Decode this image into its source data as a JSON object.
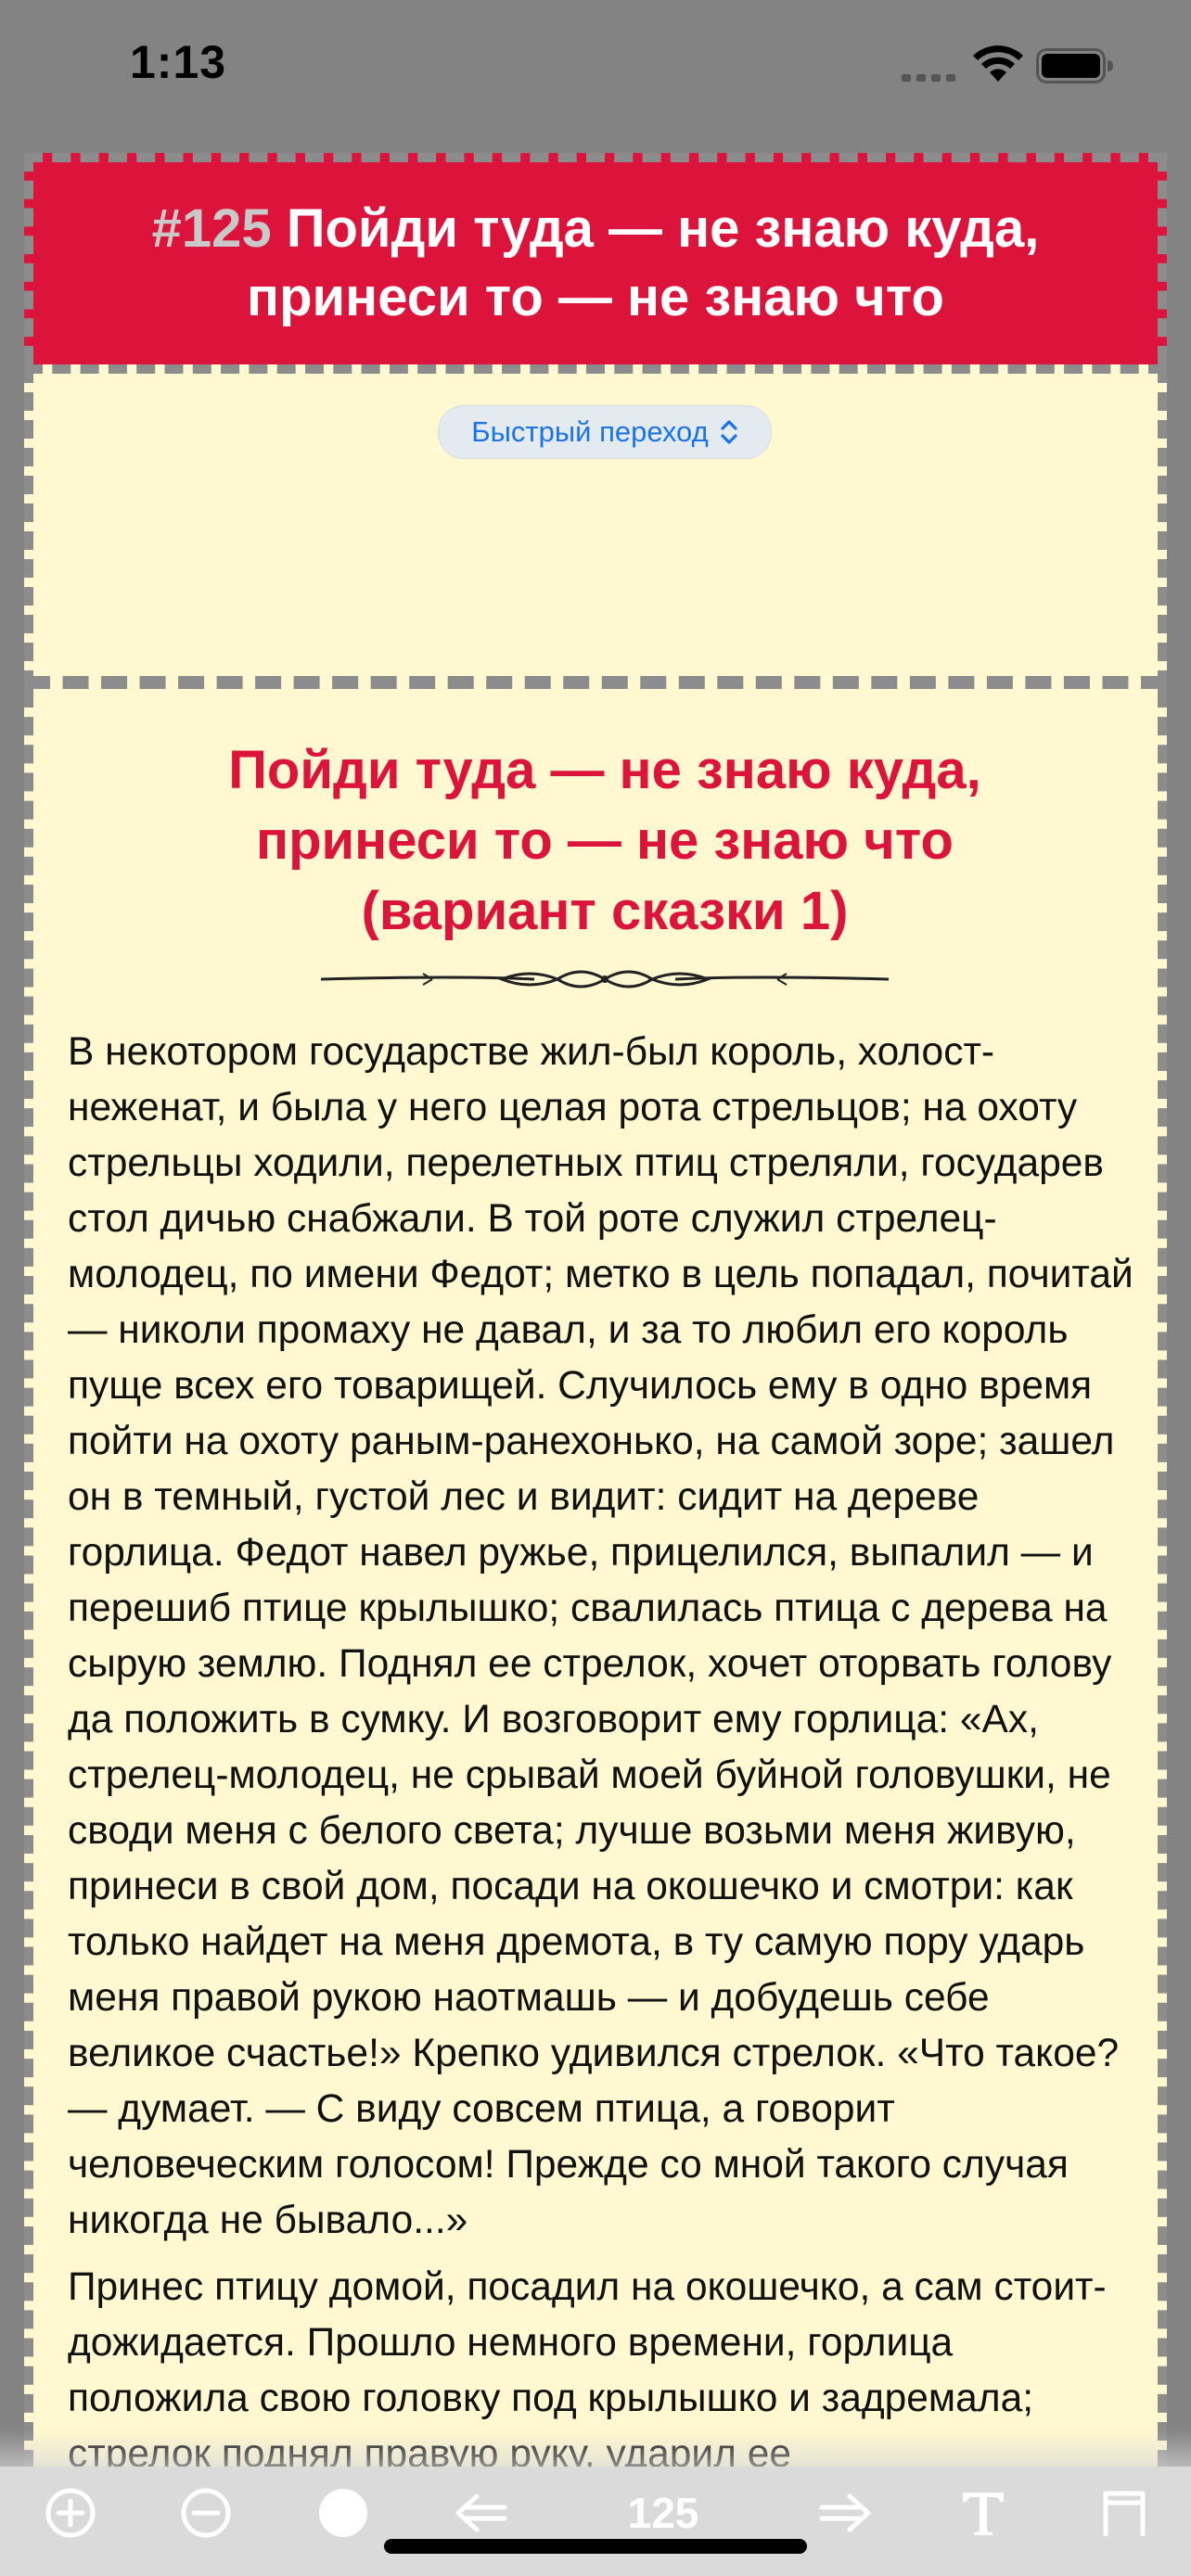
{
  "status_bar": {
    "time": "1:13"
  },
  "header": {
    "number": "#125",
    "title": "Пойди туда — не знаю куда, принеси то — не знаю что"
  },
  "quick_jump": {
    "label": "Быстрый переход"
  },
  "story": {
    "title_line1": "Пойди туда — не знаю куда,",
    "title_line2": "принеси то — не знаю что",
    "title_line3": "(вариант сказки 1)",
    "paragraph1": "В некотором государстве жил-был король, холост-неженат, и была у него целая рота стрельцов; на охоту стрельцы ходили, перелетных птиц стреляли, государев стол дичью снабжали. В той роте служил стрелец-молодец, по имени Федот; метко в цель попадал, почитай — николи промаху не давал, и за то любил его король пуще всех его товарищей. Случилось ему в одно время пойти на охоту раным-ранехонько, на самой зоре; зашел он в темный, густой лес и видит: сидит на дереве горлица. Федот навел ружье, прицелился, выпалил — и перешиб птице крылышко; свалилась птица с дерева на сырую землю. Поднял ее стрелок, хочет оторвать голову да положить в сумку. И возговорит ему горлица: «Ах, стрелец-молодец, не срывай моей буйной головушки, не своди меня с белого света; лучше возьми меня живую, принеси в свой дом, посади на окошечко и смотри: как только найдет на меня дремота, в ту самую пору ударь меня правой рукою наотмашь — и добудешь себе великое счастье!» Крепко удивился стрелок. «Что такое? — думает. — С виду совсем птица, а говорит человеческим голосом! Прежде со мной такого случая никогда не бывало...»",
    "paragraph2": "Принес птицу домой, посадил на окошечко, а сам стоит-дожидается. Прошло немного времени, горлица положила свою головку под крылышко и задремала; стрелок поднял правую руку, ударил ее"
  },
  "toolbar": {
    "page_number": "125",
    "icons": [
      "zoom-in-icon",
      "zoom-out-icon",
      "night-mode-icon",
      "previous-icon",
      "next-icon",
      "font-icon",
      "bookmark-icon"
    ]
  },
  "colors": {
    "accent": "#dc143c",
    "paper": "#fff8d0",
    "frame": "#838383",
    "link": "#1a73e8"
  }
}
